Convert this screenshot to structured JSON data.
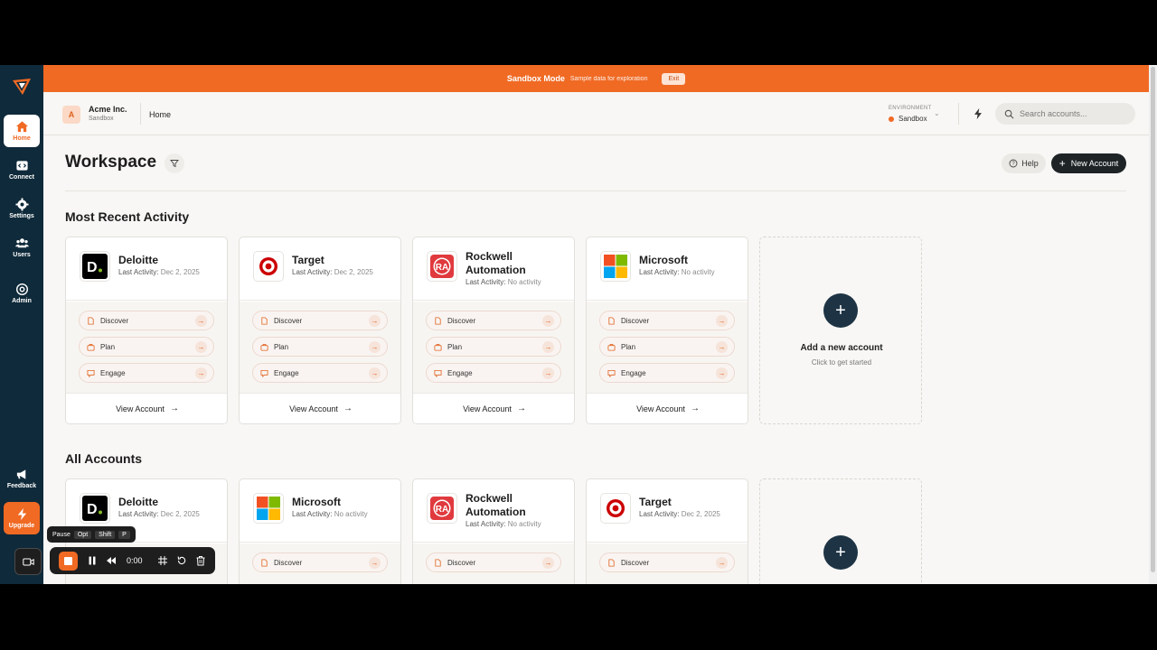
{
  "banner": {
    "title": "Sandbox Mode",
    "subtitle": "Sample data for exploration",
    "exit_label": "Exit"
  },
  "sidebar": {
    "items": [
      {
        "label": "Home"
      },
      {
        "label": "Connect"
      },
      {
        "label": "Settings"
      },
      {
        "label": "Users"
      },
      {
        "label": "Admin"
      }
    ],
    "feedback_label": "Feedback",
    "upgrade_label": "Upgrade"
  },
  "topbar": {
    "org_initial": "A",
    "org_name": "Acme Inc.",
    "org_sub": "Sandbox",
    "breadcrumb": "Home",
    "env_label": "ENVIRONMENT",
    "env_value": "Sandbox",
    "search_placeholder": "Search accounts..."
  },
  "workspace": {
    "title": "Workspace",
    "help_label": "Help",
    "new_account_label": "New Account"
  },
  "recent": {
    "title": "Most Recent Activity",
    "cards": [
      {
        "name": "Deloitte",
        "activity_prefix": "Last Activity:",
        "activity_value": "Dec 2, 2025"
      },
      {
        "name": "Target",
        "activity_prefix": "Last Activity:",
        "activity_value": "Dec 2, 2025"
      },
      {
        "name": "Rockwell Automation",
        "activity_prefix": "Last Activity:",
        "activity_value": "No activity"
      },
      {
        "name": "Microsoft",
        "activity_prefix": "Last Activity:",
        "activity_value": "No activity"
      }
    ],
    "add_title": "Add a new account",
    "add_sub": "Click to get started"
  },
  "all": {
    "title": "All Accounts",
    "cards": [
      {
        "name": "Deloitte",
        "activity_prefix": "Last Activity:",
        "activity_value": "Dec 2, 2025"
      },
      {
        "name": "Microsoft",
        "activity_prefix": "Last Activity:",
        "activity_value": "No activity"
      },
      {
        "name": "Rockwell Automation",
        "activity_prefix": "Last Activity:",
        "activity_value": "No activity"
      },
      {
        "name": "Target",
        "activity_prefix": "Last Activity:",
        "activity_value": "Dec 2, 2025"
      }
    ]
  },
  "actions": {
    "discover": "Discover",
    "plan": "Plan",
    "engage": "Engage",
    "view_account": "View Account"
  },
  "recorder": {
    "tooltip_label": "Pause",
    "keys": [
      "Opt",
      "Shift",
      "P"
    ],
    "time": "0:00"
  },
  "colors": {
    "brand_orange": "#f06a24",
    "sidebar_navy": "#0f2a3a"
  }
}
